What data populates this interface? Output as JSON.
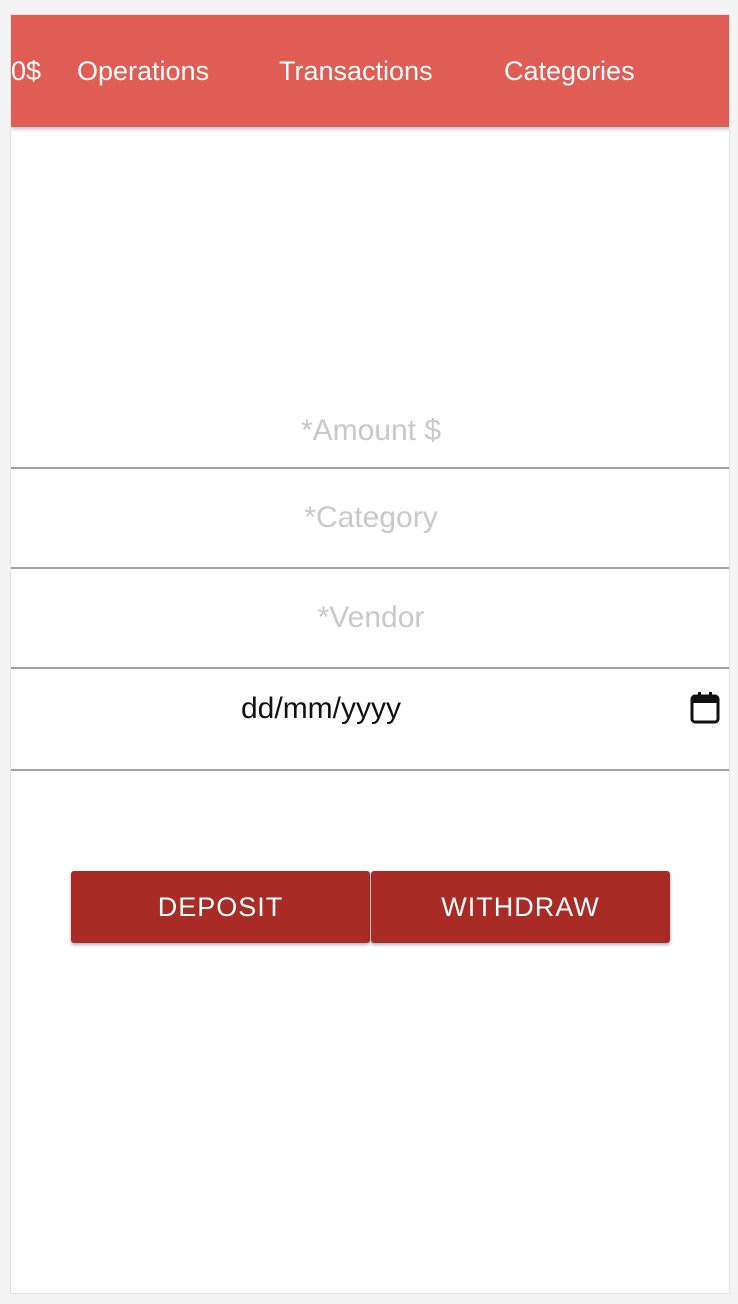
{
  "navbar": {
    "balance": "0$",
    "links": [
      "Operations",
      "Transactions",
      "Categories"
    ]
  },
  "form": {
    "amount_placeholder": "*Amount $",
    "category_placeholder": "*Category",
    "vendor_placeholder": "*Vendor",
    "date_placeholder": "dd/mm/yyyy"
  },
  "actions": {
    "deposit_label": "DEPOSIT",
    "withdraw_label": "WITHDRAW"
  },
  "colors": {
    "navbar_bg": "#e05d55",
    "button_bg": "#a92b25",
    "placeholder": "#c9c9c9"
  },
  "icons": {
    "date_picker": "calendar-icon"
  }
}
